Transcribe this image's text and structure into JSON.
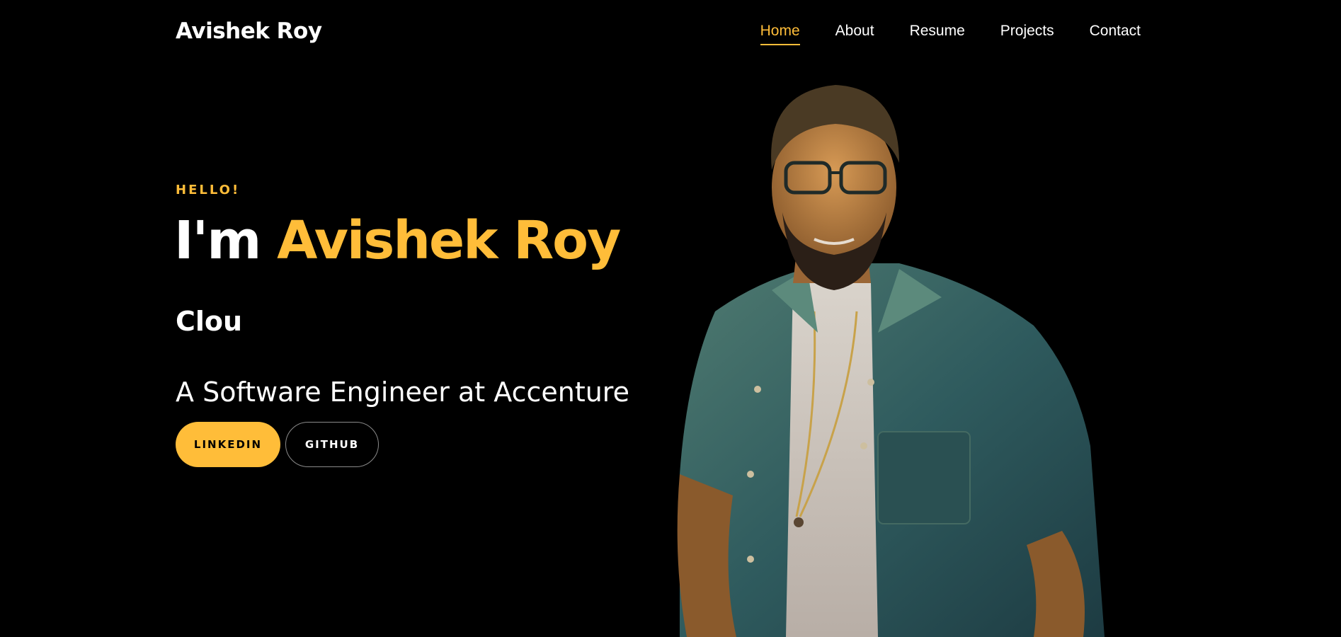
{
  "brand": {
    "name": "Avishek Roy"
  },
  "nav": {
    "items": [
      {
        "label": "Home",
        "active": true
      },
      {
        "label": "About",
        "active": false
      },
      {
        "label": "Resume",
        "active": false
      },
      {
        "label": "Projects",
        "active": false
      },
      {
        "label": "Contact",
        "active": false
      }
    ]
  },
  "hero": {
    "eyebrow": "HELLO!",
    "headline_prefix": "I'm ",
    "headline_name": "Avishek Roy",
    "typed_text": "Clou",
    "subtitle": "A Software Engineer at Accenture",
    "buttons": {
      "linkedin": "LINKEDIN",
      "github": "GITHUB"
    },
    "portrait_icon": "person-photo-icon"
  },
  "colors": {
    "background": "#000000",
    "accent": "#ffbd39",
    "text": "#ffffff"
  }
}
